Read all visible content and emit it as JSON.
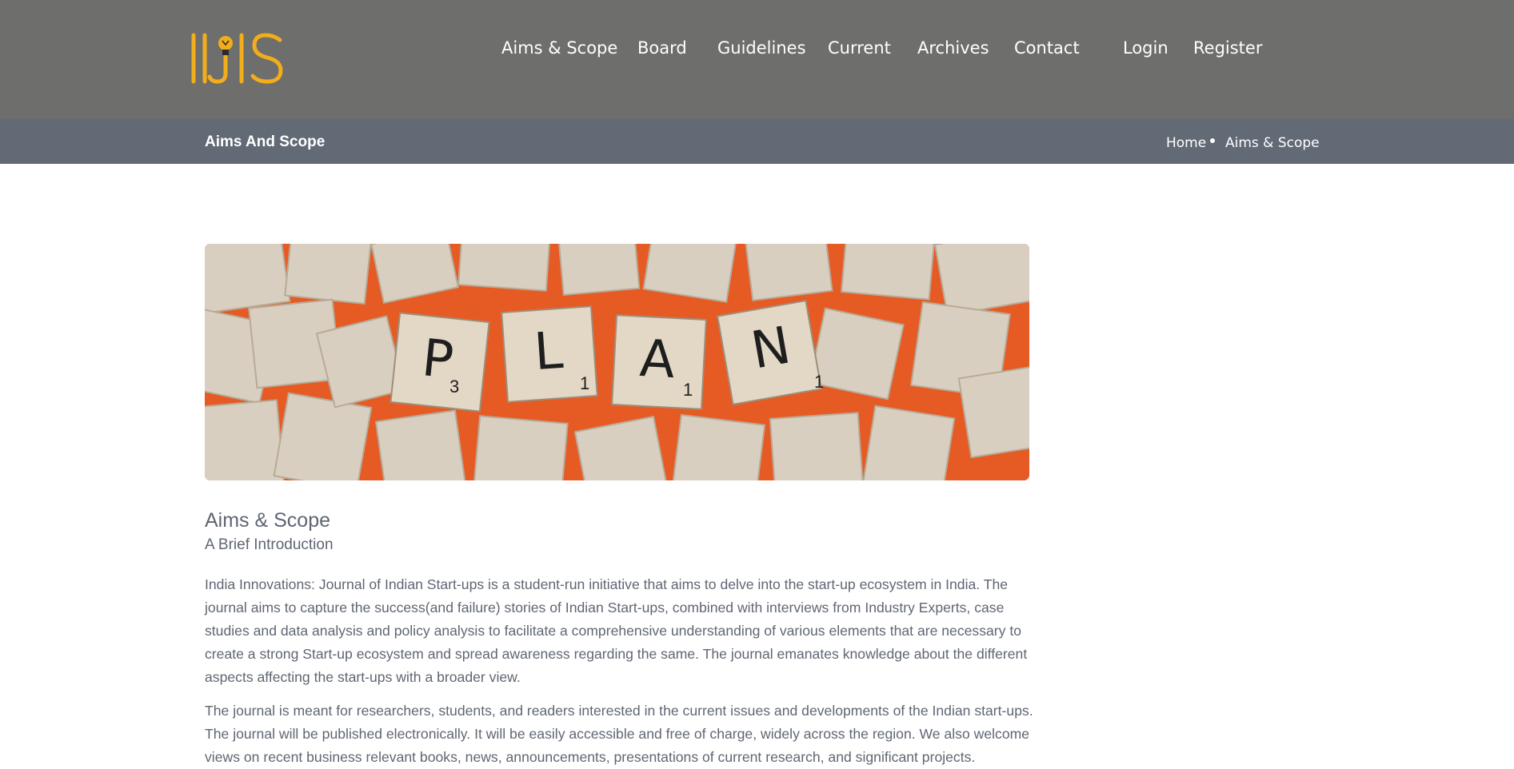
{
  "brand": {
    "logo_text": "IIJIS",
    "accent": "#f2ad1b"
  },
  "nav": {
    "items": [
      "Aims & Scope",
      "Board",
      "Guidelines",
      "Current",
      "Archives",
      "Contact"
    ],
    "login": "Login",
    "register": "Register"
  },
  "subheader": {
    "title": "Aims And Scope",
    "breadcrumb": [
      "Home",
      "Aims & Scope"
    ]
  },
  "hero": {
    "tiles": [
      "P",
      "L",
      "A",
      "N"
    ],
    "tile_scores": [
      "3",
      "1",
      "1",
      "1"
    ]
  },
  "content": {
    "title": "Aims & Scope",
    "subtitle": "A Brief Introduction",
    "paragraphs": [
      "India Innovations: Journal of Indian Start-ups is a student-run initiative that aims to delve into the start-up ecosystem in India. The journal aims to capture the success(and failure) stories of Indian Start-ups, combined with interviews from Industry Experts, case studies and data analysis and policy analysis to facilitate a comprehensive understanding of various elements that are necessary to create a strong Start-up ecosystem and spread awareness regarding the same. The journal emanates knowledge about the different aspects affecting the start-ups with a broader view.",
      "The journal is meant for researchers, students, and readers interested in the current issues and developments of the Indian start-ups. The journal will be published electronically. It will be easily accessible and free of charge, widely across the region. We also welcome views on recent business relevant books, news, announcements, presentations of current research, and significant projects."
    ]
  }
}
